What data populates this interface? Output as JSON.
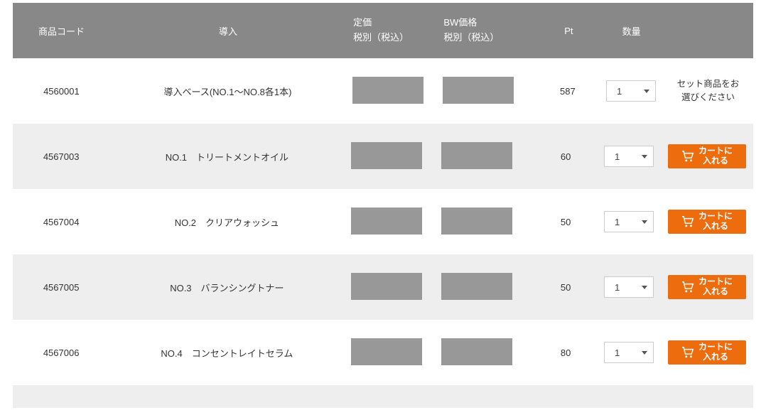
{
  "headers": {
    "code": "商品コード",
    "name": "導入",
    "price": "定価\n税別（税込）",
    "bwprice": "BW価格\n税別（税込）",
    "pt": "Pt",
    "qty": "数量"
  },
  "cart_button_label": "カートに\n入れる",
  "set_message": "セット商品をお\n選びください",
  "rows": [
    {
      "code": "4560001",
      "name": "導入ベース(NO.1〜NO.8各1本)",
      "pt": "587",
      "qty": "1",
      "action": "message"
    },
    {
      "code": "4567003",
      "name": "NO.1　トリートメントオイル",
      "pt": "60",
      "qty": "1",
      "action": "cart"
    },
    {
      "code": "4567004",
      "name": "NO.2　クリアウォッシュ",
      "pt": "50",
      "qty": "1",
      "action": "cart"
    },
    {
      "code": "4567005",
      "name": "NO.3　バランシングトナー",
      "pt": "50",
      "qty": "1",
      "action": "cart"
    },
    {
      "code": "4567006",
      "name": "NO.4　コンセントレイトセラム",
      "pt": "80",
      "qty": "1",
      "action": "cart"
    }
  ]
}
